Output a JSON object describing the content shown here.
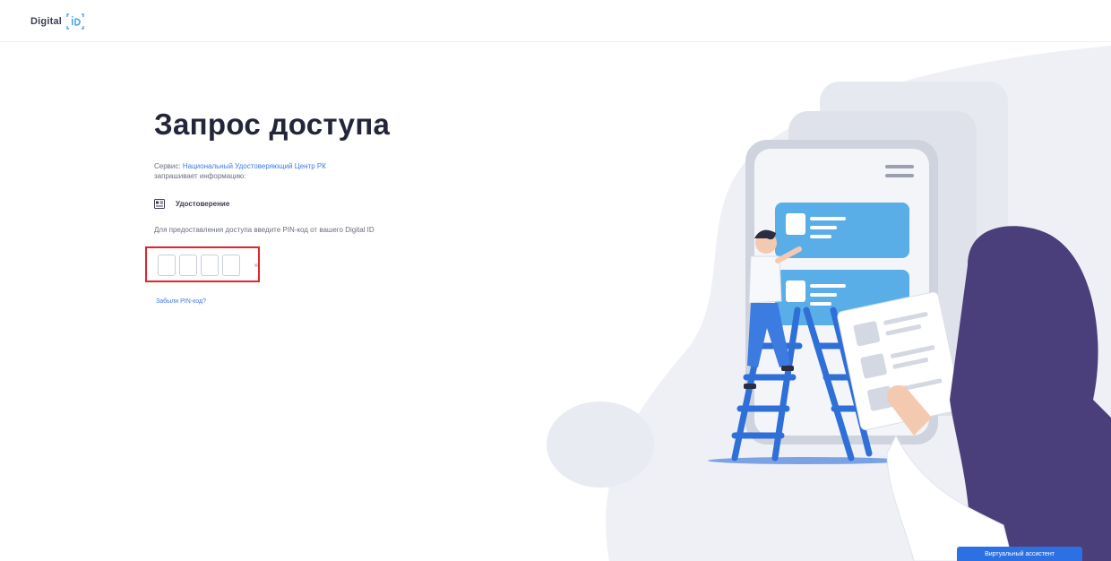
{
  "header": {
    "logo_text": "Digital",
    "logo_icon": "id-mark-icon"
  },
  "main": {
    "title": "Запрос доступа",
    "service_prefix": "Сервис",
    "service_name": "Национальный Удостоверяющий Центр РК",
    "service_suffix": "запрашивает информацию:",
    "scope_icon": "document-icon",
    "scope_label": "Удостоверение",
    "pin_hint": "Для предоставления доступа введите PIN-код от вашего Digital ID",
    "pin_values": [
      "",
      "",
      "",
      ""
    ],
    "forgot_link": "Забыли PIN-код?"
  },
  "footer": {
    "assistant_button": "Виртуальный ассистент"
  },
  "colors": {
    "accent": "#2d70e3",
    "highlight": "#e3242b",
    "illustration_blue": "#5aaee8",
    "illustration_purple": "#4a3f7a"
  }
}
